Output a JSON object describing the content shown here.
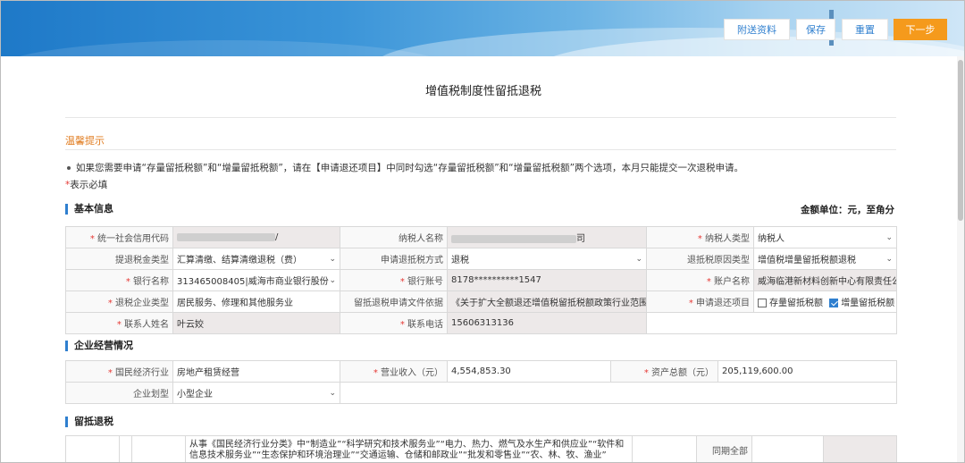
{
  "toolbar": {
    "attach_label": "附送资料",
    "save_label": "保存",
    "reset_label": "重置",
    "next_label": "下一步"
  },
  "page": {
    "title": "增值税制度性留抵退税"
  },
  "tips": {
    "title": "温馨提示",
    "text": "如果您需要申请“存量留抵税额”和“增量留抵税额”，请在【申请退还项目】中同时勾选“存量留抵税额”和“增量留抵税额”两个选项，本月只能提交一次退税申请。",
    "required_mark": "*",
    "required_text": "表示必填"
  },
  "basic_info": {
    "title": "基本信息",
    "unit": "金额单位：元，至角分",
    "labels": {
      "credit_code": "统一社会信用代码",
      "taxpayer_name": "纳税人名称",
      "taxpayer_type": "纳税人类型",
      "filing_type": "提退税金类型",
      "refund_method": "申请退抵税方式",
      "refund_reason_type": "退抵税原因类型",
      "bank_name": "银行名称",
      "bank_account": "银行账号",
      "account_name": "账户名称",
      "enterprise_type": "退税企业类型",
      "policy_basis": "留抵退税申请文件依据",
      "refund_items": "申请退还项目",
      "contact_name": "联系人姓名",
      "contact_phone": "联系电话"
    },
    "values": {
      "credit_code_tail": "/",
      "taxpayer_name_tail": "司",
      "taxpayer_type": "纳税人",
      "filing_type": "汇算清缴、结算清缴退税（费）",
      "refund_method": "退税",
      "refund_reason_type": "增值税增量留抵税额退税",
      "bank_name": "313465008405|威海市商业银行股份",
      "bank_account": "8178**********1547",
      "account_name": "威海临港新材料创新中心有限责任公司",
      "enterprise_type": "居民服务、修理和其他服务业",
      "policy_basis": "《关于扩大全额退还增值税留抵税额政策行业范围的公",
      "refund_item_1": "存量留抵税额",
      "refund_item_2": "增量留抵税额",
      "contact_name": "叶云姣",
      "contact_phone": "15606313136"
    }
  },
  "operations": {
    "title": "企业经营情况",
    "labels": {
      "industry": "国民经济行业",
      "revenue": "营业收入（元）",
      "total_assets": "资产总额（元）",
      "scale": "企业划型"
    },
    "values": {
      "industry": "房地产租赁经营",
      "revenue": "4,554,853.30",
      "total_assets": "205,119,600.00",
      "scale": "小型企业"
    }
  },
  "refund": {
    "title": "留抵退税",
    "desc_line1": "从事《国民经济行业分类》中“制造业”“科学研究和技术服务业”“电力、热力、燃气及水生产和供应业”“软件和",
    "desc_line2": "信息技术服务业”“生态保护和环境治理业”“交通运输、仓储和邮政业”“批发和零售业”“农、林、牧、渔业”",
    "side_label": "同期全部"
  }
}
